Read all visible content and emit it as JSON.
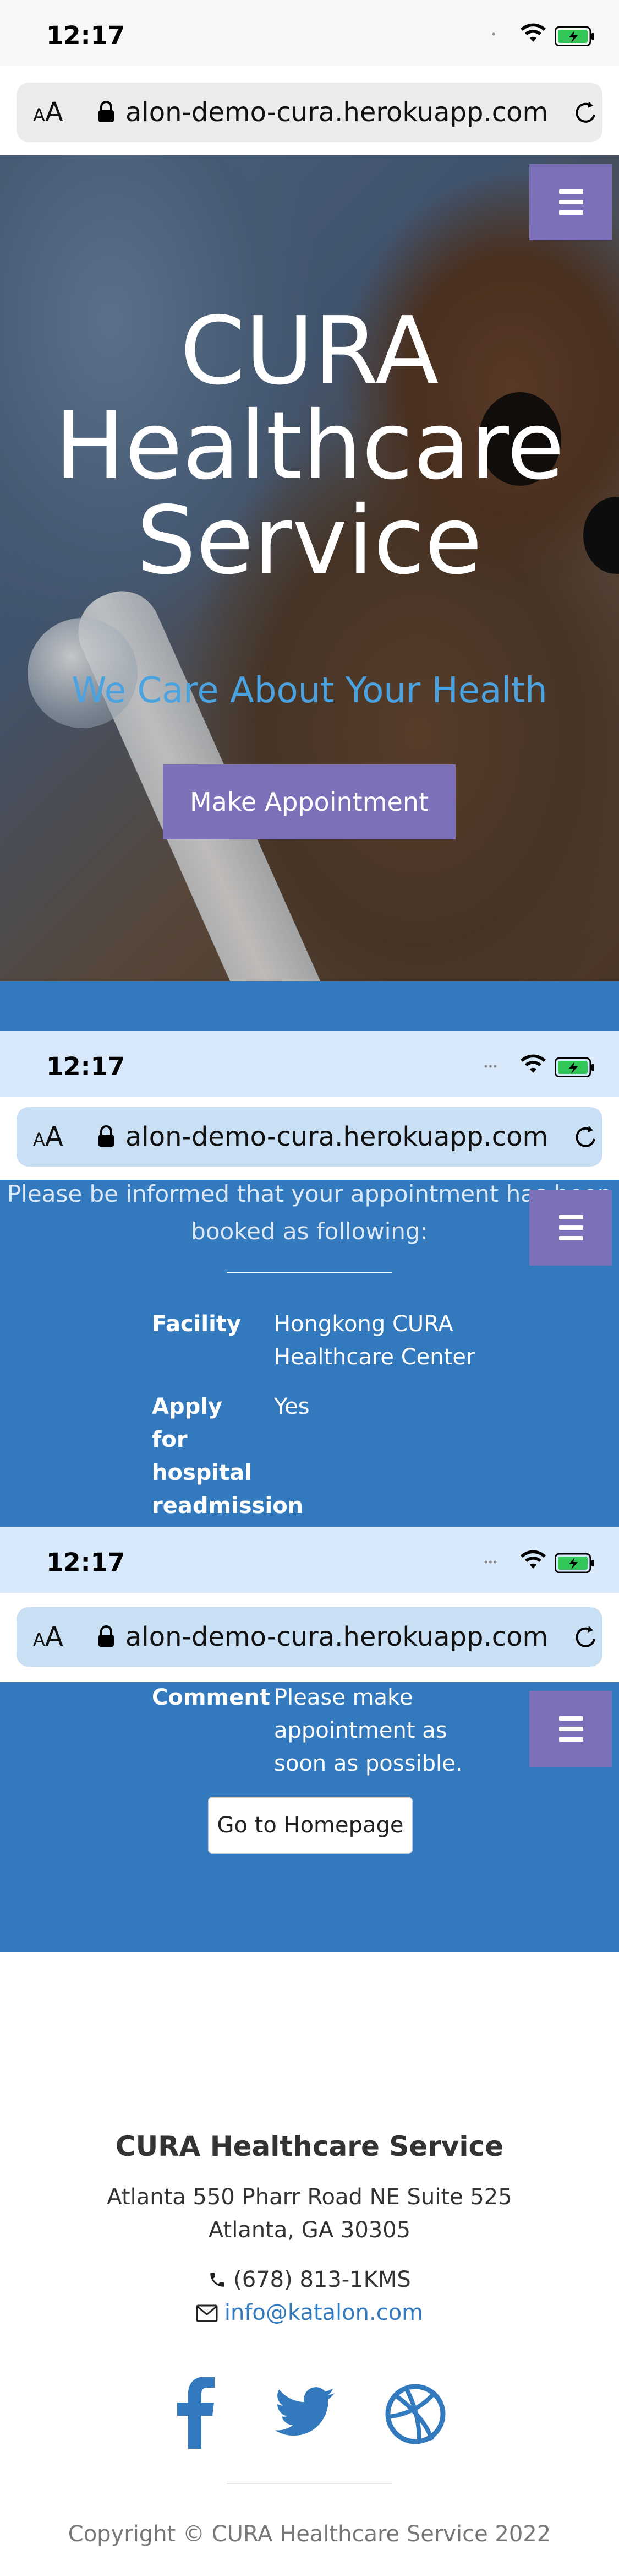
{
  "statusbar": {
    "time": "12:17"
  },
  "urlbar": {
    "text_scrolled": "alon-demo-cura.herokuapp.com",
    "aa_label": "AA"
  },
  "hero": {
    "title_line1": "CURA",
    "title_line2": "Healthcare",
    "title_line3": "Service",
    "subtitle": "We Care About Your Health",
    "appointment_button": "Make Appointment"
  },
  "confirmation": {
    "intro_line1": "Please be informed that your appointment has been",
    "intro_line2": "booked as following:",
    "rows": [
      {
        "label": "Facility",
        "value_line1": "Hongkong CURA",
        "value_line2": "Healthcare Center"
      },
      {
        "label_line1": "Apply",
        "label_line2": "for",
        "label_line3": "hospital",
        "label_line4": "readmission",
        "value": "Yes"
      },
      {
        "label": "Comment",
        "value_line1": "Please make",
        "value_line2": "appointment as",
        "value_line3": "soon as possible."
      }
    ],
    "home_button": "Go to Homepage"
  },
  "footer": {
    "title": "CURA Healthcare Service",
    "address_line1": "Atlanta 550 Pharr Road NE Suite 525",
    "address_line2": "Atlanta, GA 30305",
    "phone": "(678) 813-1KMS",
    "email": "info@katalon.com",
    "copyright": "Copyright © CURA Healthcare Service 2022"
  },
  "colors": {
    "brand_blue": "#3379bd",
    "menu_purple": "#7c71b8",
    "subtitle_blue": "#4aa3e0"
  },
  "icons": [
    "wifi-icon",
    "battery-icon",
    "lock-icon",
    "reload-icon",
    "menu-icon",
    "phone-icon",
    "envelope-icon",
    "facebook-icon",
    "twitter-icon",
    "dribbble-icon"
  ]
}
